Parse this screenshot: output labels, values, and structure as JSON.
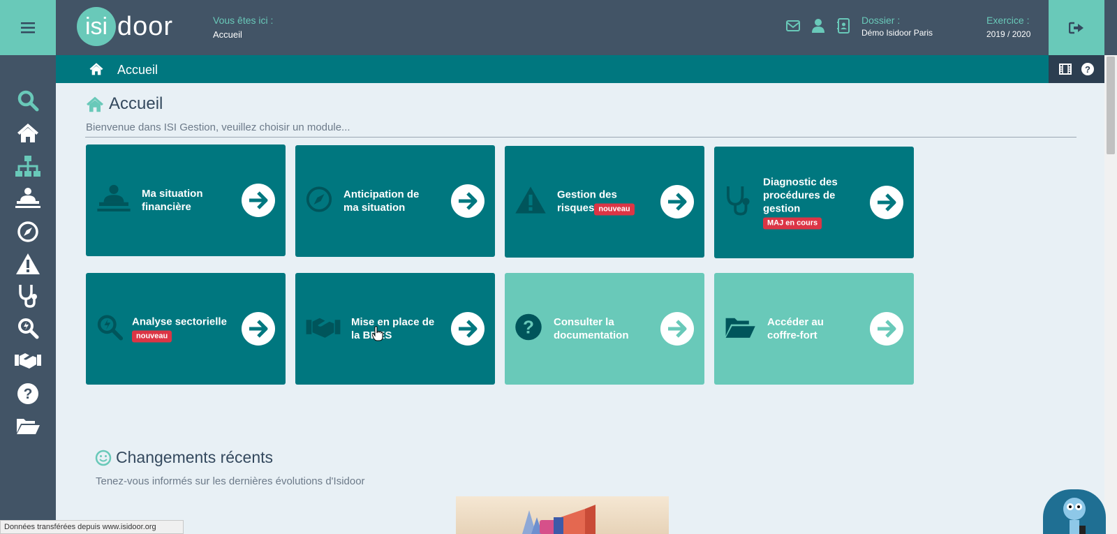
{
  "header": {
    "logo_prefix": "isi",
    "logo_suffix": "door",
    "breadcrumb_label": "Vous êtes ici :",
    "breadcrumb_value": "Accueil",
    "dossier_label": "Dossier :",
    "dossier_value": "Démo Isidoor Paris",
    "exercice_label": "Exercice :",
    "exercice_value": "2019 / 2020"
  },
  "subheader": {
    "title": "Accueil"
  },
  "main": {
    "title": "Accueil",
    "subtitle": "Bienvenue dans ISI Gestion, veuillez choisir un module..."
  },
  "modules": [
    {
      "line1": "Ma situation",
      "line2": "financière",
      "line3": "",
      "badge": ""
    },
    {
      "line1": "Anticipation de",
      "line2": "ma situation",
      "line3": "",
      "badge": ""
    },
    {
      "line1": "Gestion des",
      "line2": "risques",
      "line3": "",
      "badge": "nouveau"
    },
    {
      "line1": "Diagnostic des",
      "line2": "procédures de",
      "line3": "gestion",
      "badge": "MAJ en cours"
    },
    {
      "line1": "Analyse sectorielle",
      "line2": "",
      "line3": "",
      "badge": "nouveau"
    },
    {
      "line1": "Mise en place de",
      "line2": "la BDES",
      "line3": "",
      "badge": ""
    },
    {
      "line1": "Consulter la",
      "line2": "documentation",
      "line3": "",
      "badge": ""
    },
    {
      "line1": "Accéder au",
      "line2": "coffre-fort",
      "line3": "",
      "badge": ""
    }
  ],
  "recent": {
    "title": "Changements récents",
    "subtitle": "Tenez-vous informés sur les dernières évolutions d'Isidoor"
  },
  "statusbar": {
    "text": "Données transférées depuis www.isidoor.org"
  },
  "colors": {
    "dark_teal": "#00777f",
    "light_teal": "#69c9b9",
    "header": "#425466",
    "badge_red": "#dc3545"
  }
}
